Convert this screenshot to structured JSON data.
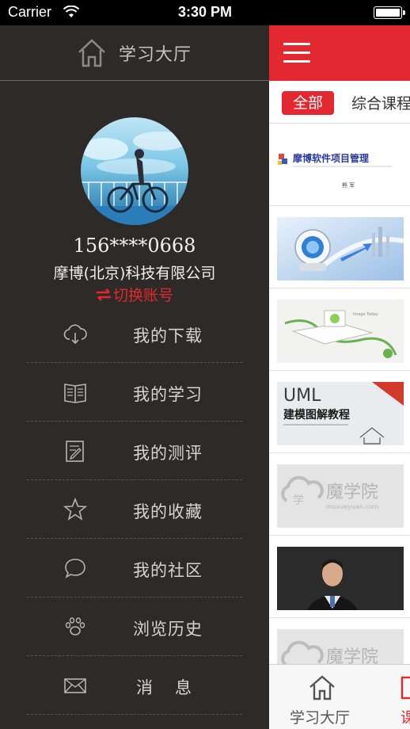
{
  "status_bar": {
    "carrier": "Carrier",
    "time": "3:30 PM"
  },
  "drawer": {
    "header_title": "学习大厅",
    "phone": "156****0668",
    "company": "摩博(北京)科技有限公司",
    "switch_account": "切换账号",
    "menu": [
      {
        "label": "我的下载",
        "icon": "cloud-download-icon"
      },
      {
        "label": "我的学习",
        "icon": "book-icon"
      },
      {
        "label": "我的测评",
        "icon": "edit-note-icon"
      },
      {
        "label": "我的收藏",
        "icon": "star-icon"
      },
      {
        "label": "我的社区",
        "icon": "chat-bubble-icon"
      },
      {
        "label": "浏览历史",
        "icon": "paw-icon"
      },
      {
        "label": "消息",
        "icon": "mail-icon"
      }
    ]
  },
  "main": {
    "tabs": {
      "all": "全部",
      "comprehensive": "综合课程"
    },
    "courses": [
      {
        "thumb_title": "摩博软件项目管理",
        "thumb_author": "熊 军"
      },
      {
        "thumb_title": ""
      },
      {
        "thumb_title": ""
      },
      {
        "thumb_title": "UML",
        "thumb_subtitle": "建模图解教程"
      },
      {
        "thumb_title": "魔学院",
        "thumb_url": "moxueyuan.com"
      },
      {
        "thumb_title": ""
      },
      {
        "thumb_title": "魔学院"
      }
    ],
    "tabbar": {
      "home": "学习大厅",
      "course": "课"
    }
  },
  "colors": {
    "accent": "#e32831",
    "drawer_bg": "#2d2a28"
  }
}
